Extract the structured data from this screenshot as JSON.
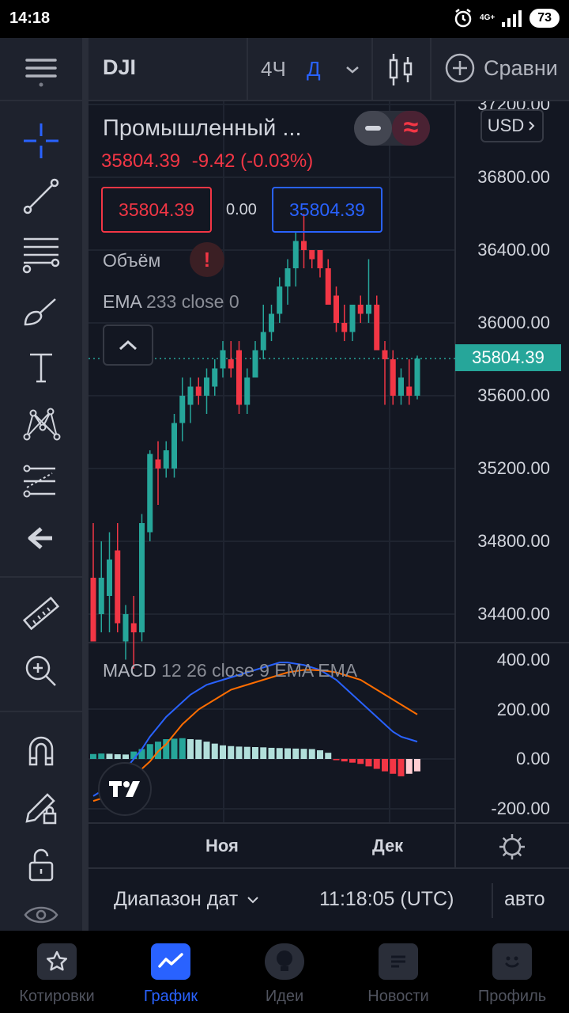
{
  "status_bar": {
    "time": "14:18",
    "network": "4G+",
    "battery": "73"
  },
  "toolbar": {
    "symbol": "DJI",
    "interval_4h": "4Ч",
    "interval_day": "Д",
    "compare_label": "Сравни"
  },
  "legend": {
    "title": "Промышленный ...",
    "last": "35804.39",
    "change": "-9.42 (-0.03%)",
    "sell_price": "35804.39",
    "spread": "0.00",
    "buy_price": "35804.39",
    "volume_label": "Объём",
    "volume_warning": "!",
    "ema_name": "EMA",
    "ema_params": "233 close 0",
    "currency": "USD",
    "currency_chevron": "›"
  },
  "price_axis": {
    "labels": [
      "37200.00",
      "36800.00",
      "36400.00",
      "36000.00",
      "35600.00",
      "35200.00",
      "34800.00",
      "34400.00"
    ],
    "last_price_label": "35804.39"
  },
  "macd": {
    "name": "MACD",
    "params": "12 26 close 9 EMA EMA",
    "axis_labels": [
      "400.00",
      "200.00",
      "0.00",
      "-200.00"
    ]
  },
  "time_axis": {
    "labels": [
      "Ноя",
      "Дек"
    ]
  },
  "info_bar": {
    "range_label": "Диапазон дат",
    "clock": "11:18:05 (UTC)",
    "scale_mode": "авто"
  },
  "bottom_nav": [
    {
      "label": "Котировки",
      "icon": "star-icon",
      "active": false
    },
    {
      "label": "График",
      "icon": "chart-icon",
      "active": true
    },
    {
      "label": "Идеи",
      "icon": "bulb-icon",
      "active": false
    },
    {
      "label": "Новости",
      "icon": "news-icon",
      "active": false
    },
    {
      "label": "Профиль",
      "icon": "smile-icon",
      "active": false
    }
  ],
  "colors": {
    "up": "#26a69a",
    "down": "#f23645",
    "accent": "#2962ff",
    "background": "#131722"
  },
  "chart_data": {
    "type": "candlestick",
    "symbol": "DJI",
    "ylim": [
      34200,
      37200
    ],
    "last_price": 35804.39,
    "x_ticks": [
      "Ноя",
      "Дек"
    ],
    "candles": [
      {
        "o": 34600,
        "h": 34900,
        "l": 34300,
        "c": 34250
      },
      {
        "o": 34400,
        "h": 34800,
        "l": 34300,
        "c": 34600
      },
      {
        "o": 34500,
        "h": 34850,
        "l": 34300,
        "c": 34700
      },
      {
        "o": 34750,
        "h": 34900,
        "l": 34300,
        "c": 34350
      },
      {
        "o": 34250,
        "h": 34450,
        "l": 34150,
        "c": 34400
      },
      {
        "o": 34350,
        "h": 34500,
        "l": 34100,
        "c": 34300
      },
      {
        "o": 34300,
        "h": 34950,
        "l": 34250,
        "c": 34900
      },
      {
        "o": 34850,
        "h": 35300,
        "l": 34800,
        "c": 35280
      },
      {
        "o": 35250,
        "h": 35350,
        "l": 35000,
        "c": 35200
      },
      {
        "o": 35200,
        "h": 35350,
        "l": 35150,
        "c": 35300
      },
      {
        "o": 35200,
        "h": 35500,
        "l": 35150,
        "c": 35450
      },
      {
        "o": 35450,
        "h": 35700,
        "l": 35350,
        "c": 35600
      },
      {
        "o": 35550,
        "h": 35700,
        "l": 35450,
        "c": 35650
      },
      {
        "o": 35650,
        "h": 35700,
        "l": 35550,
        "c": 35600
      },
      {
        "o": 35600,
        "h": 35750,
        "l": 35500,
        "c": 35700
      },
      {
        "o": 35650,
        "h": 35800,
        "l": 35600,
        "c": 35750
      },
      {
        "o": 35750,
        "h": 35900,
        "l": 35700,
        "c": 35850
      },
      {
        "o": 35800,
        "h": 35900,
        "l": 35700,
        "c": 35750
      },
      {
        "o": 35850,
        "h": 35900,
        "l": 35500,
        "c": 35550
      },
      {
        "o": 35550,
        "h": 35750,
        "l": 35500,
        "c": 35700
      },
      {
        "o": 35700,
        "h": 35900,
        "l": 35700,
        "c": 35850
      },
      {
        "o": 35850,
        "h": 36100,
        "l": 35800,
        "c": 35950
      },
      {
        "o": 35950,
        "h": 36100,
        "l": 35900,
        "c": 36050
      },
      {
        "o": 36050,
        "h": 36250,
        "l": 36000,
        "c": 36200
      },
      {
        "o": 36200,
        "h": 36350,
        "l": 36100,
        "c": 36300
      },
      {
        "o": 36300,
        "h": 36500,
        "l": 36200,
        "c": 36450
      },
      {
        "o": 36450,
        "h": 36600,
        "l": 36300,
        "c": 36400
      },
      {
        "o": 36400,
        "h": 36400,
        "l": 36300,
        "c": 36350
      },
      {
        "o": 36400,
        "h": 36400,
        "l": 36250,
        "c": 36300
      },
      {
        "o": 36300,
        "h": 36350,
        "l": 36100,
        "c": 36100
      },
      {
        "o": 36150,
        "h": 36200,
        "l": 35950,
        "c": 36000
      },
      {
        "o": 36000,
        "h": 36100,
        "l": 35900,
        "c": 35950
      },
      {
        "o": 35950,
        "h": 36100,
        "l": 35900,
        "c": 36100
      },
      {
        "o": 36100,
        "h": 36150,
        "l": 36000,
        "c": 36050
      },
      {
        "o": 36050,
        "h": 36350,
        "l": 36000,
        "c": 36100
      },
      {
        "o": 36100,
        "h": 36150,
        "l": 35850,
        "c": 35850
      },
      {
        "o": 35850,
        "h": 35900,
        "l": 35550,
        "c": 35800
      },
      {
        "o": 35800,
        "h": 35850,
        "l": 35550,
        "c": 35600
      },
      {
        "o": 35600,
        "h": 35750,
        "l": 35550,
        "c": 35700
      },
      {
        "o": 35650,
        "h": 35800,
        "l": 35550,
        "c": 35600
      },
      {
        "o": 35600,
        "h": 35820,
        "l": 35580,
        "c": 35804
      }
    ],
    "macd_histogram": [
      20,
      22,
      21,
      19,
      18,
      30,
      40,
      60,
      70,
      80,
      82,
      84,
      80,
      78,
      70,
      62,
      55,
      52,
      50,
      49,
      48,
      47,
      45,
      44,
      43,
      42,
      41,
      40,
      35,
      25,
      -5,
      -10,
      -15,
      -20,
      -30,
      -40,
      -50,
      -60,
      -70,
      -60,
      -50
    ],
    "macd_line": [
      -150,
      -130,
      -110,
      -80,
      -40,
      0,
      40,
      90,
      130,
      170,
      200,
      230,
      260,
      280,
      300,
      310,
      320,
      330,
      340,
      350,
      360,
      370,
      380,
      390,
      390,
      385,
      380,
      370,
      360,
      340,
      320,
      290,
      260,
      230,
      200,
      170,
      140,
      110,
      90,
      80,
      70
    ],
    "signal_line": [
      -170,
      -160,
      -140,
      -120,
      -100,
      -70,
      -40,
      -10,
      30,
      60,
      100,
      140,
      170,
      200,
      220,
      240,
      260,
      280,
      290,
      300,
      310,
      320,
      330,
      340,
      350,
      355,
      360,
      360,
      358,
      355,
      350,
      340,
      330,
      320,
      300,
      280,
      260,
      240,
      220,
      200,
      180
    ]
  }
}
